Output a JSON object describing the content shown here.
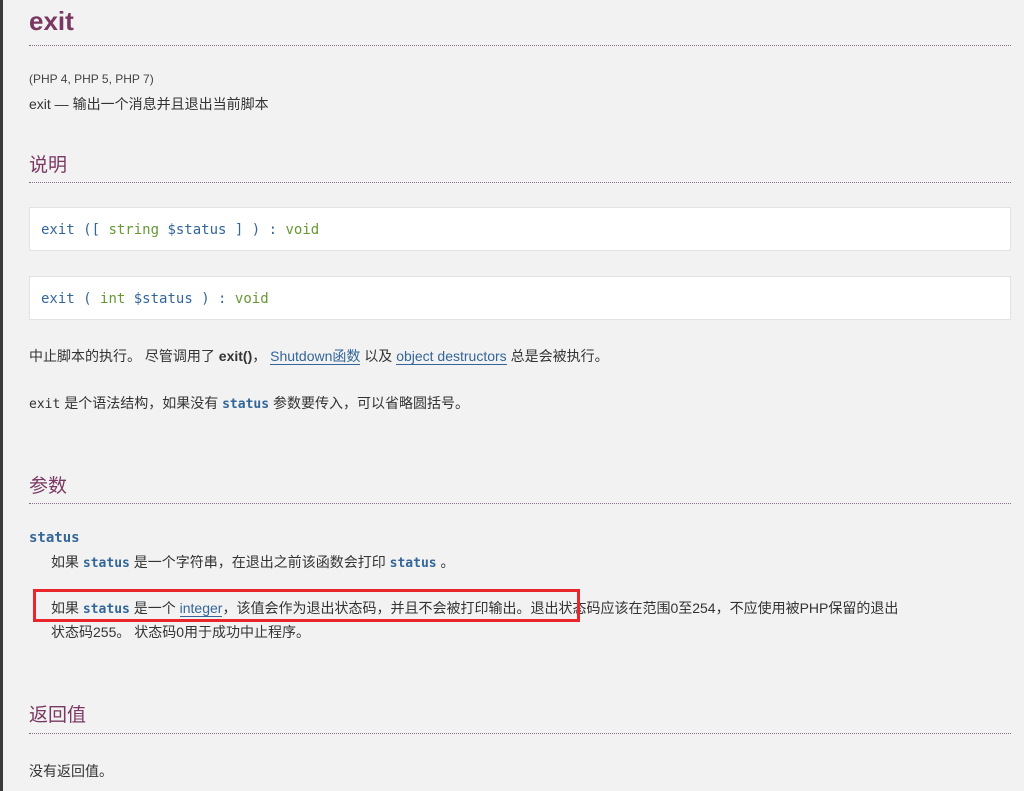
{
  "page": {
    "title": "exit",
    "versions": "(PHP 4, PHP 5, PHP 7)",
    "refpurpose": "exit — 输出一个消息并且退出当前脚本"
  },
  "description": {
    "heading": "说明",
    "synopses": [
      {
        "name": "exit",
        "open": " ([ ",
        "type": "string",
        "var": "$status",
        "close": " ] ) : ",
        "returns": "void"
      },
      {
        "name": "exit",
        "open": " ( ",
        "type": "int",
        "var": "$status",
        "close": " ) : ",
        "returns": "void"
      }
    ],
    "para1": {
      "t1": "中止脚本的执行。 尽管调用了 ",
      "fn": "exit()",
      "t2": "， ",
      "link1": "Shutdown函数",
      "t3": " 以及 ",
      "link2": "object destructors",
      "t4": " 总是会被执行。"
    },
    "para2": {
      "code": "exit",
      "t1": " 是个语法结构，如果没有 ",
      "param": "status",
      "t2": " 参数要传入，可以省略圆括号。"
    }
  },
  "parameters": {
    "heading": "参数",
    "term": "status",
    "line1": {
      "t1": "如果 ",
      "param": "status",
      "t2": " 是一个字符串，在退出之前该函数会打印 ",
      "param2": "status",
      "t3": " 。"
    },
    "line2": {
      "t1": "如果 ",
      "param": "status",
      "t2": " 是一个 ",
      "link": "integer",
      "t3": "，该值会作为退出状态码，并且不会被打印输出。退出状态码应该在范围0至254，不应使用被PHP保留的退出",
      "t4": "状态码255。 状态码0用于成功中止程序。"
    }
  },
  "returnvalues": {
    "heading": "返回值",
    "text": "没有返回值。"
  },
  "colors": {
    "heading": "#793862",
    "link": "#336699",
    "type": "#669933",
    "highlight": "#e8262b"
  }
}
